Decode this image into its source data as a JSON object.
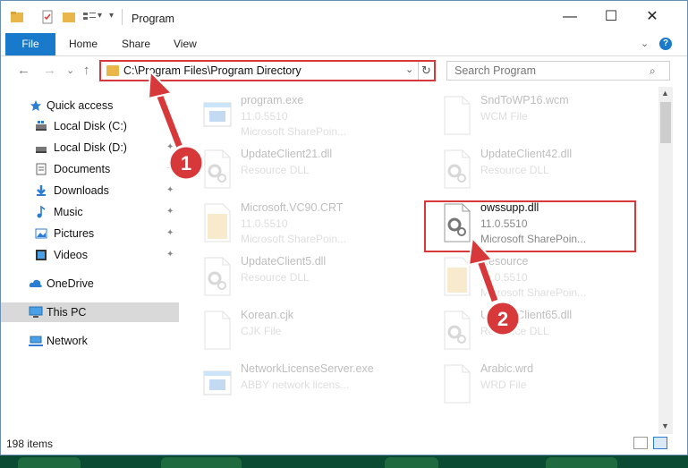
{
  "titlebar": {
    "title": "Program",
    "min_glyph": "—",
    "max_glyph": "☐",
    "close_glyph": "✕"
  },
  "ribbon": {
    "tabs": [
      "File",
      "Home",
      "Share",
      "View"
    ],
    "help_glyph": "?",
    "caret_glyph": "⌄"
  },
  "nav": {
    "back_glyph": "←",
    "forward_glyph": "→",
    "recent_glyph": "⌄",
    "up_glyph": "↑",
    "address": "C:\\Program Files\\Program Directory",
    "address_dropdown_glyph": "⌄",
    "refresh_glyph": "↻",
    "search_placeholder": "Search Program",
    "search_glyph": "⌕"
  },
  "sidebar": {
    "items": [
      {
        "label": "Quick access",
        "icon": "star-icon",
        "pinned": false
      },
      {
        "label": "Local Disk (C:)",
        "icon": "drive-icon",
        "pinned": true
      },
      {
        "label": "Local Disk (D:)",
        "icon": "drive-icon",
        "pinned": true
      },
      {
        "label": "Documents",
        "icon": "documents-icon",
        "pinned": true
      },
      {
        "label": "Downloads",
        "icon": "download-icon",
        "pinned": true
      },
      {
        "label": "Music",
        "icon": "music-icon",
        "pinned": true
      },
      {
        "label": "Pictures",
        "icon": "pictures-icon",
        "pinned": true
      },
      {
        "label": "Videos",
        "icon": "videos-icon",
        "pinned": true
      },
      {
        "label": "OneDrive",
        "icon": "cloud-icon",
        "pinned": false
      },
      {
        "label": "This PC",
        "icon": "computer-icon",
        "pinned": false,
        "selected": true
      },
      {
        "label": "Network",
        "icon": "network-icon",
        "pinned": false
      }
    ],
    "pin_glyph": "📌"
  },
  "files": [
    {
      "name": "program.exe",
      "line2": "11.0.5510",
      "line3": "Microsoft SharePoin...",
      "icon": "exe-icon"
    },
    {
      "name": "SndToWP16.wcm",
      "line2": "WCM File",
      "line3": "",
      "icon": "blank-file-icon"
    },
    {
      "name": "UpdateClient21.dll",
      "line2": "Resource DLL",
      "line3": "",
      "icon": "dll-file-icon"
    },
    {
      "name": "UpdateClient42.dll",
      "line2": "Resource DLL",
      "line3": "",
      "icon": "dll-file-icon"
    },
    {
      "name": "Microsoft.VC90.CRT",
      "line2": "11.0.5510",
      "line3": "Microsoft SharePoin...",
      "icon": "folder-file-icon"
    },
    {
      "name": "owssupp.dll",
      "line2": "11.0.5510",
      "line3": "Microsoft SharePoin...",
      "icon": "dll-file-icon",
      "highlighted": true
    },
    {
      "name": "UpdateClient5.dll",
      "line2": "Resource DLL",
      "line3": "",
      "icon": "dll-file-icon"
    },
    {
      "name": "Resource",
      "line2": "11.0.5510",
      "line3": "Microsoft SharePoin...",
      "icon": "folder-file-icon"
    },
    {
      "name": "Korean.cjk",
      "line2": "CJK File",
      "line3": "",
      "icon": "blank-file-icon"
    },
    {
      "name": "UpdateClient65.dll",
      "line2": "Resource DLL",
      "line3": "",
      "icon": "dll-file-icon"
    },
    {
      "name": "NetworkLicenseServer.exe",
      "line2": "ABBY network licens...",
      "line3": "",
      "icon": "exe-icon"
    },
    {
      "name": "Arabic.wrd",
      "line2": "WRD File",
      "line3": "",
      "icon": "blank-file-icon"
    }
  ],
  "status": {
    "item_count": "198 items"
  },
  "annotations": {
    "step1": "1",
    "step2": "2",
    "color": "#d7393b"
  }
}
